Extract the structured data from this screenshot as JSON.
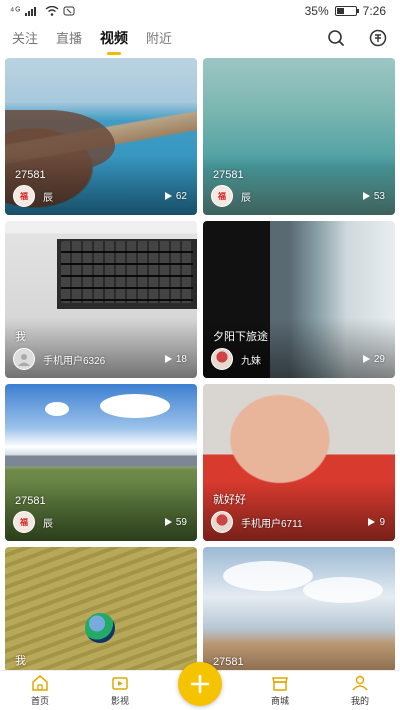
{
  "status_bar": {
    "signal": "⁴ᴳ",
    "battery": "35%",
    "time": "7:26"
  },
  "tabs": [
    {
      "label": "关注",
      "active": false
    },
    {
      "label": "直播",
      "active": false
    },
    {
      "label": "视频",
      "active": true
    },
    {
      "label": "附近",
      "active": false
    }
  ],
  "header_icons": [
    "search-icon",
    "coin-icon"
  ],
  "accent_color": "#f6c300",
  "cards": [
    {
      "caption": "27581",
      "author": "辰",
      "plays": "62",
      "avatar": "red",
      "scene": "coast"
    },
    {
      "caption": "27581",
      "author": "辰",
      "plays": "53",
      "avatar": "red",
      "scene": "water"
    },
    {
      "caption": "我",
      "author": "手机用户6326",
      "plays": "18",
      "avatar": "gray",
      "scene": "keyboard"
    },
    {
      "caption": "夕阳下旅途",
      "author": "九妹",
      "plays": "29",
      "avatar": "photo",
      "scene": "vertical"
    },
    {
      "caption": "27581",
      "author": "辰",
      "plays": "59",
      "avatar": "red",
      "scene": "mountain"
    },
    {
      "caption": "就好好",
      "author": "手机用户6711",
      "plays": "9",
      "avatar": "photo",
      "scene": "face"
    },
    {
      "caption": "我",
      "author": "",
      "plays": "",
      "avatar": "",
      "scene": "field"
    },
    {
      "caption": "27581",
      "author": "",
      "plays": "",
      "avatar": "",
      "scene": "clouds"
    }
  ],
  "bottom_nav": {
    "home": "首页",
    "film": "影视",
    "mall": "商城",
    "me": "我的"
  },
  "fab_icon": "plus-icon"
}
